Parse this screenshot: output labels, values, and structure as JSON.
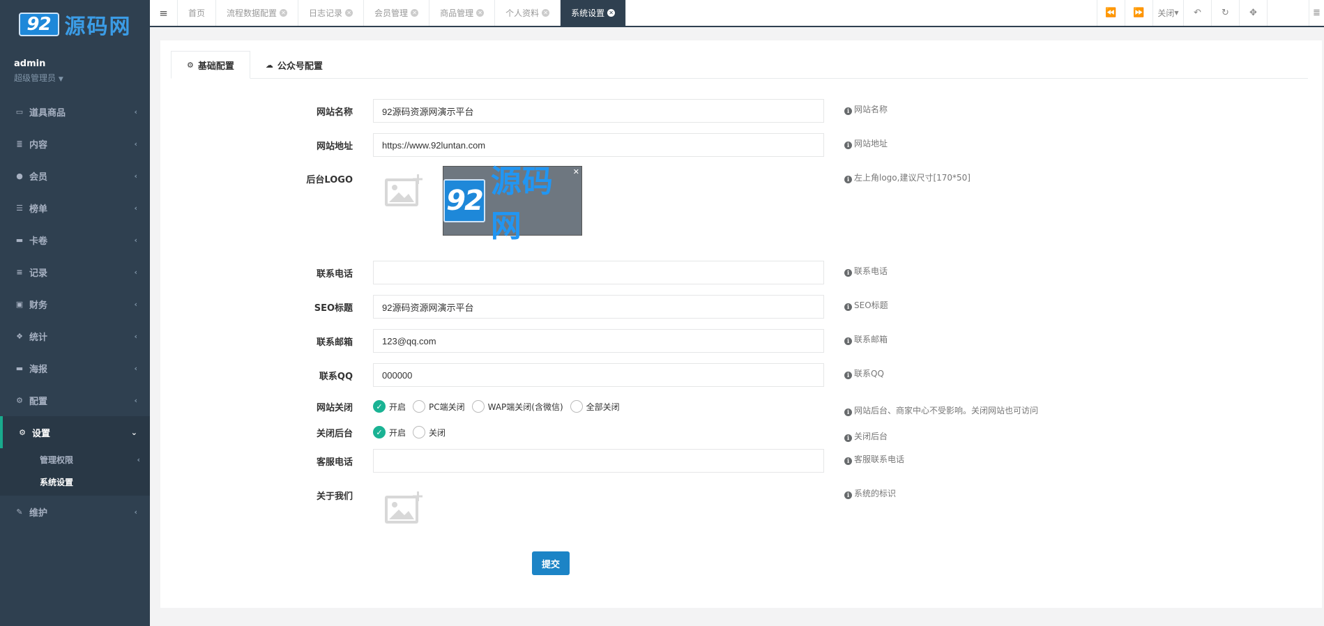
{
  "logo": {
    "badge": "92",
    "text": "源码网"
  },
  "user": {
    "name": "admin",
    "role": "超级管理员"
  },
  "nav": {
    "items": [
      {
        "label": "道具商品",
        "icon": "laptop-icon",
        "glyph": "▭"
      },
      {
        "label": "内容",
        "icon": "database-icon",
        "glyph": "≣"
      },
      {
        "label": "会员",
        "icon": "user-icon",
        "glyph": "●"
      },
      {
        "label": "榜单",
        "icon": "list-icon",
        "glyph": "☰"
      },
      {
        "label": "卡卷",
        "icon": "card-icon",
        "glyph": "▬"
      },
      {
        "label": "记录",
        "icon": "align-left-icon",
        "glyph": "≡"
      },
      {
        "label": "财务",
        "icon": "money-icon",
        "glyph": "▣"
      },
      {
        "label": "统计",
        "icon": "cubes-icon",
        "glyph": "❖"
      },
      {
        "label": "海报",
        "icon": "credit-card-icon",
        "glyph": "▬"
      },
      {
        "label": "配置",
        "icon": "cogs-icon",
        "glyph": "⚙"
      }
    ],
    "active": {
      "label": "设置",
      "icon": "gear-icon",
      "glyph": "⚙"
    },
    "sub": [
      {
        "label": "管理权限"
      },
      {
        "label": "系统设置"
      }
    ],
    "last": {
      "label": "维护",
      "icon": "magic-icon",
      "glyph": "✎"
    }
  },
  "topbar": {
    "tabs": [
      {
        "label": "首页",
        "closable": false
      },
      {
        "label": "流程数据配置",
        "closable": true
      },
      {
        "label": "日志记录",
        "closable": true
      },
      {
        "label": "会员管理",
        "closable": true
      },
      {
        "label": "商品管理",
        "closable": true
      },
      {
        "label": "个人资料",
        "closable": true
      },
      {
        "label": "系统设置",
        "closable": true,
        "active": true
      }
    ],
    "close_label": "关闭"
  },
  "content_tabs": {
    "basic": "基础配置",
    "wechat": "公众号配置"
  },
  "form": {
    "site_name": {
      "label": "网站名称",
      "value": "92源码资源网演示平台",
      "hint": "网站名称"
    },
    "site_url": {
      "label": "网站地址",
      "value": "https://www.92luntan.com",
      "hint": "网站地址"
    },
    "admin_logo": {
      "label": "后台LOGO",
      "hint": "左上角logo,建议尺寸[170*50]",
      "preview_badge": "92",
      "preview_text": "源码网"
    },
    "phone": {
      "label": "联系电话",
      "value": "",
      "hint": "联系电话"
    },
    "seo_title": {
      "label": "SEO标题",
      "value": "92源码资源网演示平台",
      "hint": "SEO标题"
    },
    "email": {
      "label": "联系邮箱",
      "value": "123@qq.com",
      "hint": "联系邮箱"
    },
    "qq": {
      "label": "联系QQ",
      "value": "000000",
      "hint": "联系QQ"
    },
    "site_close": {
      "label": "网站关闭",
      "options": [
        "开启",
        "PC端关闭",
        "WAP端关闭(含微信)",
        "全部关闭"
      ],
      "selected": "开启",
      "hint": "网站后台、商家中心不受影响。关闭网站也可访问"
    },
    "admin_close": {
      "label": "关闭后台",
      "options": [
        "开启",
        "关闭"
      ],
      "selected": "开启",
      "hint": "关闭后台"
    },
    "service_phone": {
      "label": "客服电话",
      "value": "",
      "hint": "客服联系电话"
    },
    "about": {
      "label": "关于我们",
      "hint": "系统的标识"
    },
    "submit_label": "提交"
  },
  "colors": {
    "sidebar": "#2f4050",
    "accent": "#1ab394",
    "primary": "#1c84c6"
  }
}
